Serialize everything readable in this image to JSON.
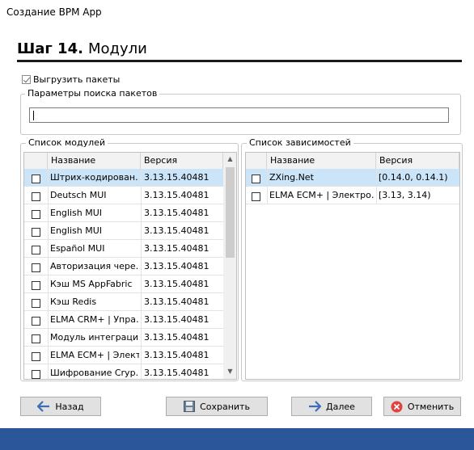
{
  "window": {
    "title": "Создание BPM App"
  },
  "header": {
    "step": "Шаг 14.",
    "name": "Модули"
  },
  "export_packages": {
    "label": "Выгрузить пакеты",
    "checked": true
  },
  "search_group": {
    "label": "Параметры поиска пакетов",
    "value": ""
  },
  "modules": {
    "label": "Список модулей",
    "columns": [
      "Название",
      "Версия"
    ],
    "rows": [
      {
        "name": "Штрих-кодирован…",
        "version": "3.13.15.40481",
        "selected": true
      },
      {
        "name": "Deutsch MUI",
        "version": "3.13.15.40481"
      },
      {
        "name": "English MUI",
        "version": "3.13.15.40481"
      },
      {
        "name": "English MUI",
        "version": "3.13.15.40481"
      },
      {
        "name": "Español MUI",
        "version": "3.13.15.40481"
      },
      {
        "name": "Авторизация чере…",
        "version": "3.13.15.40481"
      },
      {
        "name": "Кэш MS AppFabric",
        "version": "3.13.15.40481"
      },
      {
        "name": "Кэш Redis",
        "version": "3.13.15.40481"
      },
      {
        "name": "ELMA CRM+ | Упра…",
        "version": "3.13.15.40481"
      },
      {
        "name": "Модуль интеграци…",
        "version": "3.13.15.40481"
      },
      {
        "name": "ELMA ECM+ | Элект…",
        "version": "3.13.15.40481"
      },
      {
        "name": "Шифрование Cryp…",
        "version": "3.13.15.40481"
      }
    ]
  },
  "dependencies": {
    "label": "Список зависимостей",
    "columns": [
      "Название",
      "Версия"
    ],
    "rows": [
      {
        "name": "ZXing.Net",
        "version": "[0.14.0, 0.14.1)",
        "selected": true
      },
      {
        "name": "ELMA ECM+ | Электро…",
        "version": "[3.13, 3.14)"
      }
    ]
  },
  "buttons": {
    "back": "Назад",
    "save": "Сохранить",
    "next": "Далее",
    "cancel": "Отменить"
  },
  "colors": {
    "footer": "#2b579a",
    "selection": "#cce4f7",
    "cancel_icon": "#e0423d",
    "arrow_icon": "#3c6eb4"
  }
}
